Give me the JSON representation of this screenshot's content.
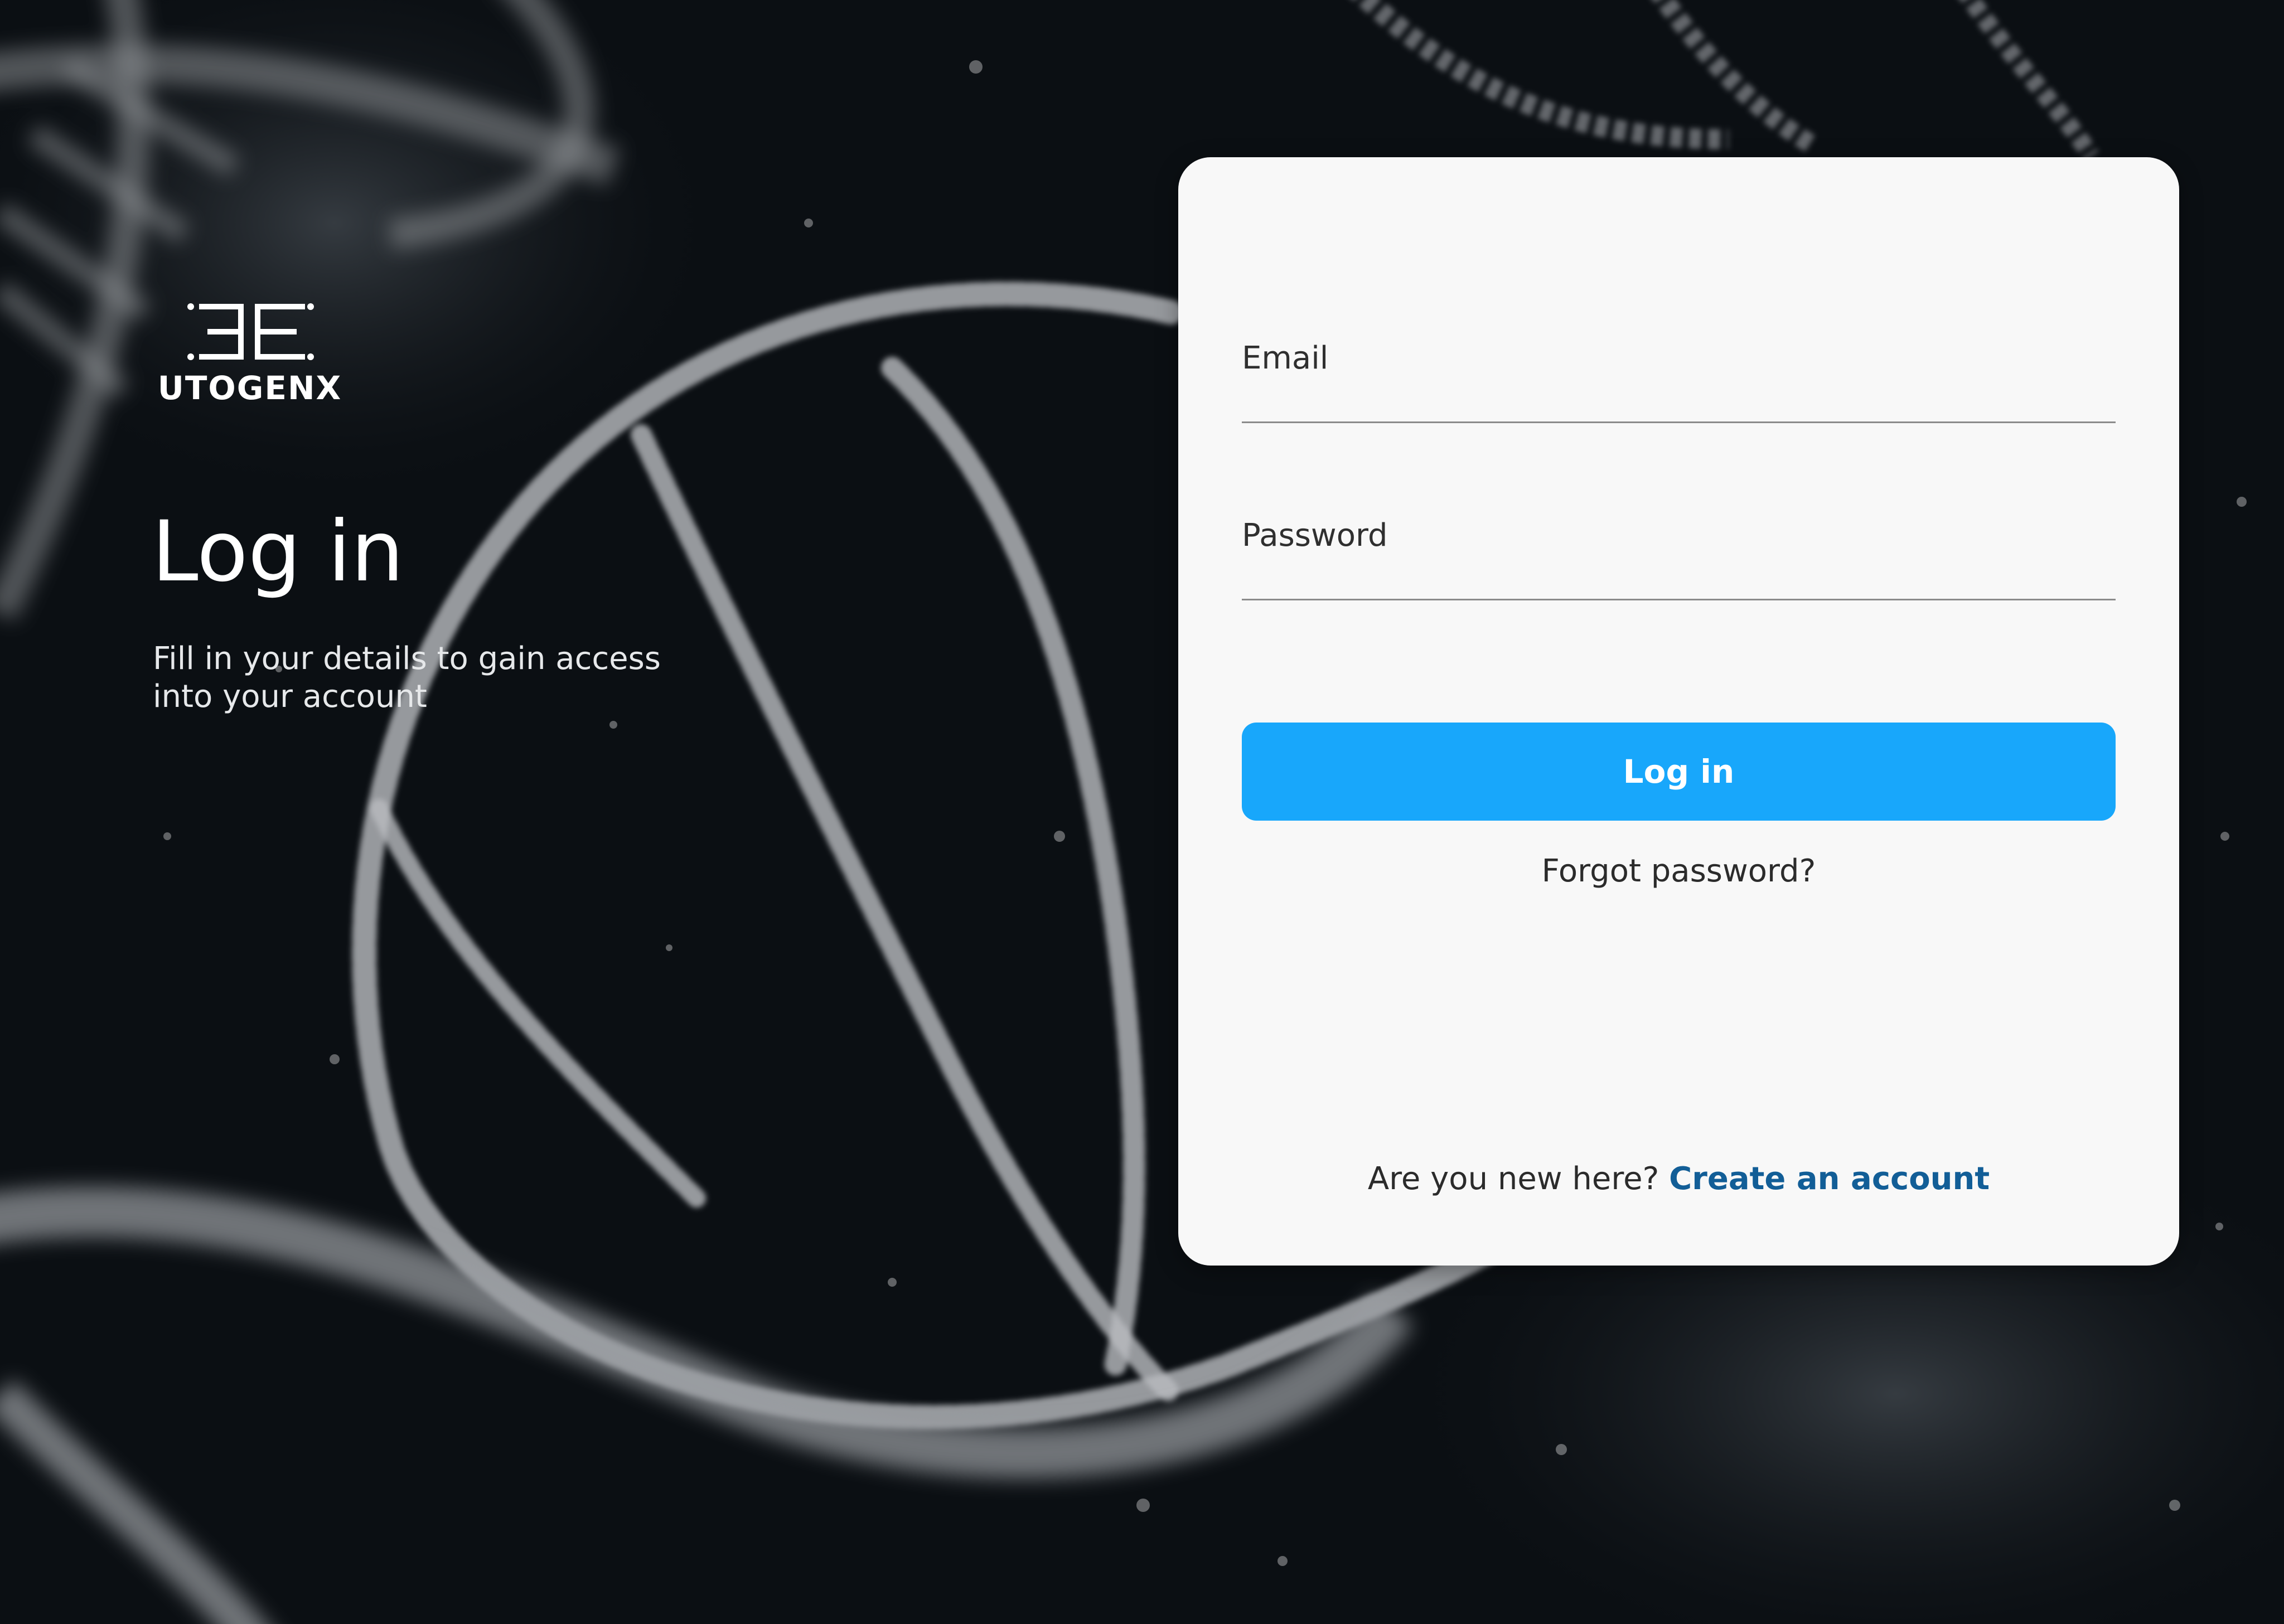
{
  "brand": {
    "name": "UTOGENX",
    "logo_icon": "utogenx-e-mark-icon"
  },
  "hero": {
    "title": "Log in",
    "subtitle": "Fill in your details to gain access into your account"
  },
  "form": {
    "email_label": "Email",
    "email_value": "",
    "password_label": "Password",
    "password_value": "",
    "submit_label": "Log in",
    "forgot_label": "Forgot password?"
  },
  "signup": {
    "prompt": "Are you new here?",
    "link_label": "Create an account"
  },
  "colors": {
    "background": "#0b0f13",
    "card": "#f8f8f8",
    "accent": "#18a7fb",
    "link": "#125e97"
  },
  "background_image": "dna-helix-particles"
}
